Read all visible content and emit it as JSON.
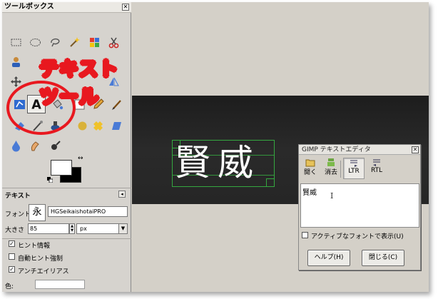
{
  "toolbox": {
    "title": "ツールボックス",
    "close_glyph": "✕",
    "tools": [
      {
        "name": "rect-select-icon"
      },
      {
        "name": "ellipse-select-icon"
      },
      {
        "name": "free-select-icon"
      },
      {
        "name": "fuzzy-select-icon"
      },
      {
        "name": "color-select-icon"
      },
      {
        "name": "scissors-icon"
      },
      {
        "name": "foreground-select-icon"
      },
      {
        "name": "paths-icon"
      },
      {
        "name": "color-picker-icon"
      },
      {
        "name": "zoom-icon"
      },
      {
        "name": "measure-icon"
      },
      {
        "name": "move-icon"
      },
      {
        "name": "align-icon"
      },
      {
        "name": "crop-icon"
      },
      {
        "name": "rotate-icon"
      },
      {
        "name": "scale-icon"
      },
      {
        "name": "shear-icon"
      },
      {
        "name": "perspective-icon"
      },
      {
        "name": "flip-icon"
      },
      {
        "name": "text-tool-icon",
        "active": true
      },
      {
        "name": "bucket-fill-icon"
      },
      {
        "name": "blend-icon"
      },
      {
        "name": "pencil-icon"
      },
      {
        "name": "paintbrush-icon"
      },
      {
        "name": "eraser-icon"
      },
      {
        "name": "airbrush-icon"
      },
      {
        "name": "ink-icon"
      },
      {
        "name": "clone-icon"
      },
      {
        "name": "heal-icon"
      },
      {
        "name": "perspective-clone-icon"
      },
      {
        "name": "blur-icon"
      },
      {
        "name": "smudge-icon"
      },
      {
        "name": "dodge-burn-icon"
      }
    ],
    "callout": "テキストツール",
    "swap_glyph": "↔"
  },
  "tool_options": {
    "title": "テキスト",
    "menu_glyph": "◂",
    "font_label": "フォント:",
    "font_button_glyph": "永",
    "font_value": "HGSeikaishotaiPRO",
    "size_label": "大きさ",
    "size_value": "85",
    "unit_value": "px",
    "unit_dropdown_glyph": "▼",
    "hinting_label": "ヒント情報",
    "hinting_checked": true,
    "force_autohint_label": "自動ヒント強制",
    "force_autohint_checked": false,
    "antialias_label": "アンチエイリアス",
    "antialias_checked": true,
    "color_label": "色:",
    "check_glyph": "✓",
    "colors": {
      "foreground": "#ffffff",
      "background": "#000000"
    }
  },
  "canvas": {
    "text": "賢威",
    "text_color": "#ffffff",
    "guide_color": "#35a840"
  },
  "text_editor": {
    "title": "GIMP テキストエディタ",
    "close_glyph": "✕",
    "open_label": "開く",
    "clear_label": "消去",
    "ltr_label": "LTR",
    "rtl_label": "RTL",
    "ltr_active": true,
    "content": "賢威",
    "cursor_glyph": "I",
    "use_selected_font_label": "アクティブなフォントで表示(U)",
    "use_selected_font_checked": false,
    "help_label": "ヘルプ(H)",
    "close_label": "閉じる(C)"
  },
  "accent": "#e8181f"
}
